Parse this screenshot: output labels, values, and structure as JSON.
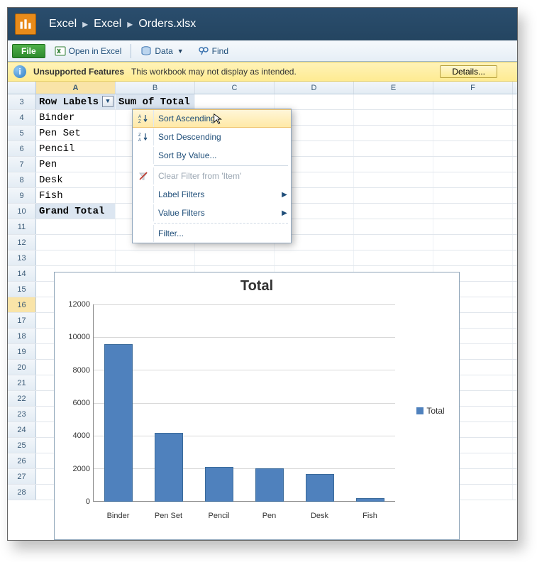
{
  "breadcrumb": {
    "app": "Excel",
    "folder": "Excel",
    "file": "Orders.xlsx"
  },
  "toolbar": {
    "file": "File",
    "open_in_excel": "Open in Excel",
    "data": "Data",
    "find": "Find"
  },
  "notify": {
    "title": "Unsupported Features",
    "message": "This workbook may not display as intended.",
    "details": "Details..."
  },
  "columns": [
    "A",
    "B",
    "C",
    "D",
    "E",
    "F"
  ],
  "rows": [
    "3",
    "4",
    "5",
    "6",
    "7",
    "8",
    "9",
    "10",
    "11",
    "12",
    "13",
    "14",
    "15",
    "16",
    "17",
    "18",
    "19",
    "20",
    "21",
    "22",
    "23",
    "24",
    "25",
    "26",
    "27",
    "28"
  ],
  "pivot": {
    "row_labels": "Row Labels",
    "sum_of_total": "Sum of Total",
    "items": [
      "Binder",
      "Pen Set",
      "Pencil",
      "Pen",
      "Desk",
      "Fish"
    ],
    "grand_total": "Grand Total"
  },
  "filter_menu": {
    "sort_asc": "Sort Ascending",
    "sort_desc": "Sort Descending",
    "sort_by_value": "Sort By Value...",
    "clear_filter": "Clear Filter from 'Item'",
    "label_filters": "Label Filters",
    "value_filters": "Value Filters",
    "filter": "Filter..."
  },
  "chart_data": {
    "type": "bar",
    "title": "Total",
    "categories": [
      "Binder",
      "Pen Set",
      "Pencil",
      "Pen",
      "Desk",
      "Fish"
    ],
    "values": [
      9600,
      4200,
      2100,
      2050,
      1700,
      200
    ],
    "series_name": "Total",
    "ylabel": "",
    "xlabel": "",
    "ylim": [
      0,
      12000
    ],
    "y_ticks": [
      0,
      2000,
      4000,
      6000,
      8000,
      10000,
      12000
    ]
  }
}
